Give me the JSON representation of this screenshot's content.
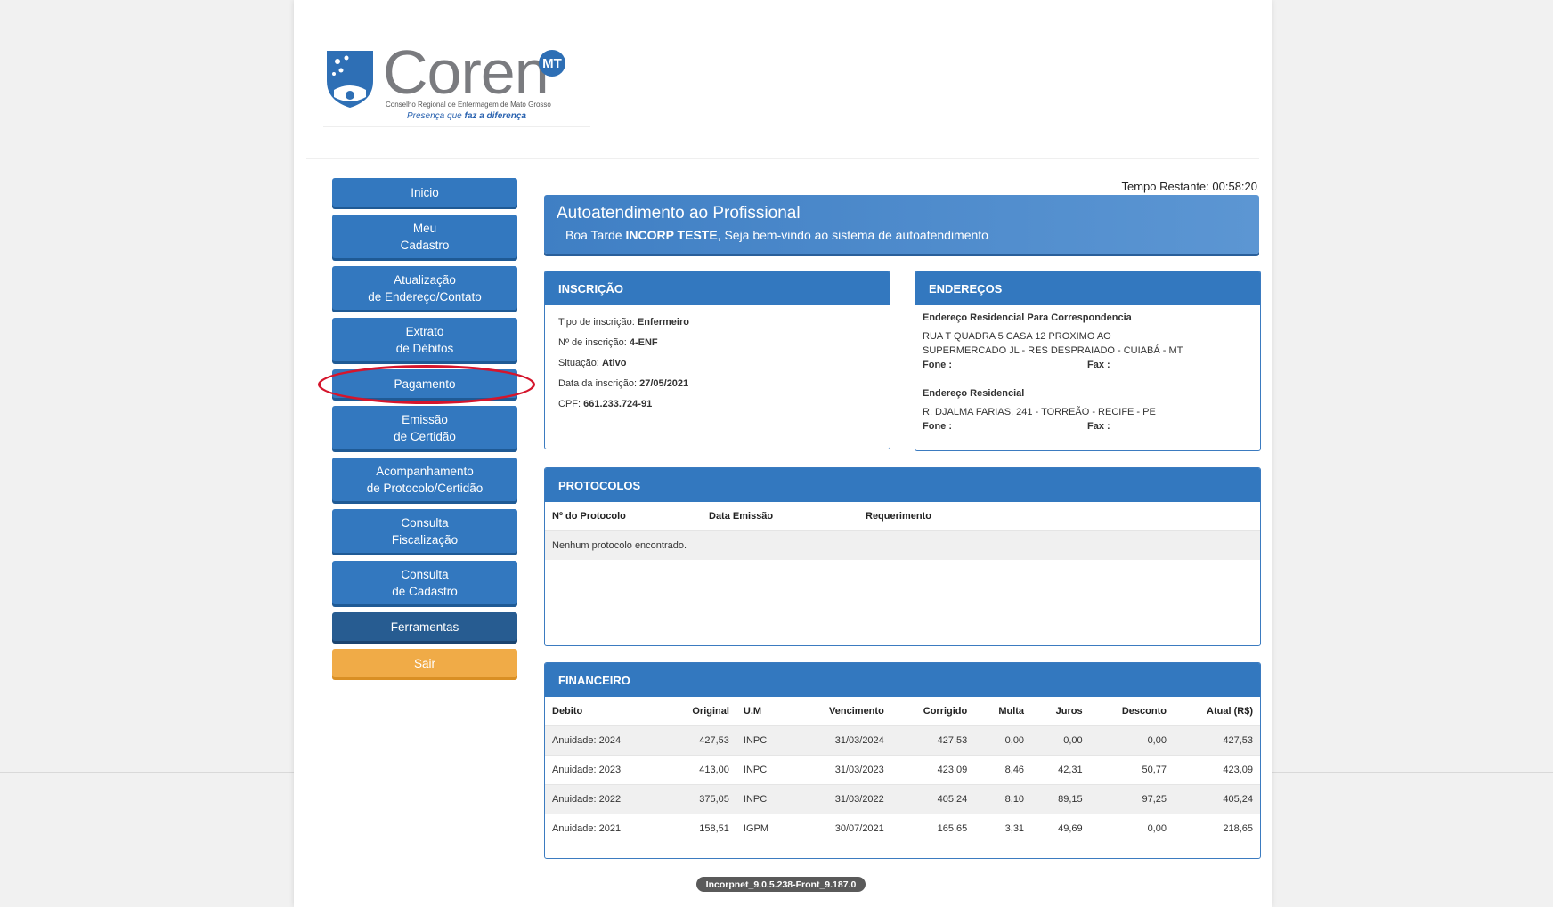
{
  "brand": {
    "name": "Coren",
    "badge": "MT",
    "subtitle": "Conselho Regional de Enfermagem de Mato Grosso",
    "tagline_prefix": "Presença que",
    "tagline_bold": "faz a diferença"
  },
  "menu": [
    {
      "lines": [
        "Inicio"
      ],
      "style": "blue"
    },
    {
      "lines": [
        "Meu",
        "Cadastro"
      ],
      "style": "blue"
    },
    {
      "lines": [
        "Atualização",
        "de Endereço/Contato"
      ],
      "style": "blue"
    },
    {
      "lines": [
        "Extrato",
        "de Débitos"
      ],
      "style": "blue"
    },
    {
      "lines": [
        "Pagamento"
      ],
      "style": "blue"
    },
    {
      "lines": [
        "Emissão",
        "de Certidão"
      ],
      "style": "blue"
    },
    {
      "lines": [
        "Acompanhamento",
        "de Protocolo/Certidão"
      ],
      "style": "blue"
    },
    {
      "lines": [
        "Consulta",
        "Fiscalização"
      ],
      "style": "blue"
    },
    {
      "lines": [
        "Consulta",
        "de Cadastro"
      ],
      "style": "blue"
    },
    {
      "lines": [
        "Ferramentas"
      ],
      "style": "dark"
    },
    {
      "lines": [
        "Sair"
      ],
      "style": "orange"
    }
  ],
  "timer": "Tempo Restante: 00:58:20",
  "welcome": {
    "title": "Autoatendimento ao Profissional",
    "greeting": "Boa Tarde",
    "user": "INCORP TESTE",
    "message": ", Seja bem-vindo ao sistema de autoatendimento"
  },
  "inscricao": {
    "header": "INSCRIÇÃO",
    "fields": [
      {
        "label": "Tipo de inscrição:",
        "value": "Enfermeiro"
      },
      {
        "label": "Nº de inscrição:",
        "value": "4-ENF"
      },
      {
        "label": "Situação:",
        "value": "Ativo"
      },
      {
        "label": "Data da inscrição:",
        "value": "27/05/2021"
      },
      {
        "label": "CPF:",
        "value": "661.233.724-91"
      }
    ]
  },
  "enderecos": {
    "header": "ENDEREÇOS",
    "items": [
      {
        "title": "Endereço Residencial Para Correspondencia",
        "lines": [
          "RUA T QUADRA 5 CASA 12 PROXIMO AO",
          "SUPERMERCADO JL - RES DESPRAIADO - CUIABÁ - MT"
        ],
        "fone": "Fone :",
        "fax": "Fax :"
      },
      {
        "title": "Endereço Residencial",
        "lines": [
          "R. DJALMA FARIAS, 241 - TORREÃO - RECIFE - PE"
        ],
        "fone": "Fone :",
        "fax": "Fax :"
      }
    ]
  },
  "protocolos": {
    "header": "PROTOCOLOS",
    "columns": [
      "Nº do Protocolo",
      "Data Emissão",
      "Requerimento"
    ],
    "empty": "Nenhum protocolo encontrado."
  },
  "financeiro": {
    "header": "FINANCEIRO",
    "columns": [
      "Debito",
      "Original",
      "U.M",
      "Vencimento",
      "Corrigido",
      "Multa",
      "Juros",
      "Desconto",
      "Atual (R$)"
    ],
    "rows": [
      [
        "Anuidade: 2024",
        "427,53",
        "INPC",
        "31/03/2024",
        "427,53",
        "0,00",
        "0,00",
        "0,00",
        "427,53"
      ],
      [
        "Anuidade: 2023",
        "413,00",
        "INPC",
        "31/03/2023",
        "423,09",
        "8,46",
        "42,31",
        "50,77",
        "423,09"
      ],
      [
        "Anuidade: 2022",
        "375,05",
        "INPC",
        "31/03/2022",
        "405,24",
        "8,10",
        "89,15",
        "97,25",
        "405,24"
      ],
      [
        "Anuidade: 2021",
        "158,51",
        "IGPM",
        "30/07/2021",
        "165,65",
        "3,31",
        "49,69",
        "0,00",
        "218,65"
      ]
    ]
  },
  "version": "Incorpnet_9.0.5.238-Front_9.187.0",
  "colors": {
    "primary": "#3378bf",
    "dark": "#275c91",
    "exit": "#f0ab47",
    "highlight": "#d5152c"
  }
}
